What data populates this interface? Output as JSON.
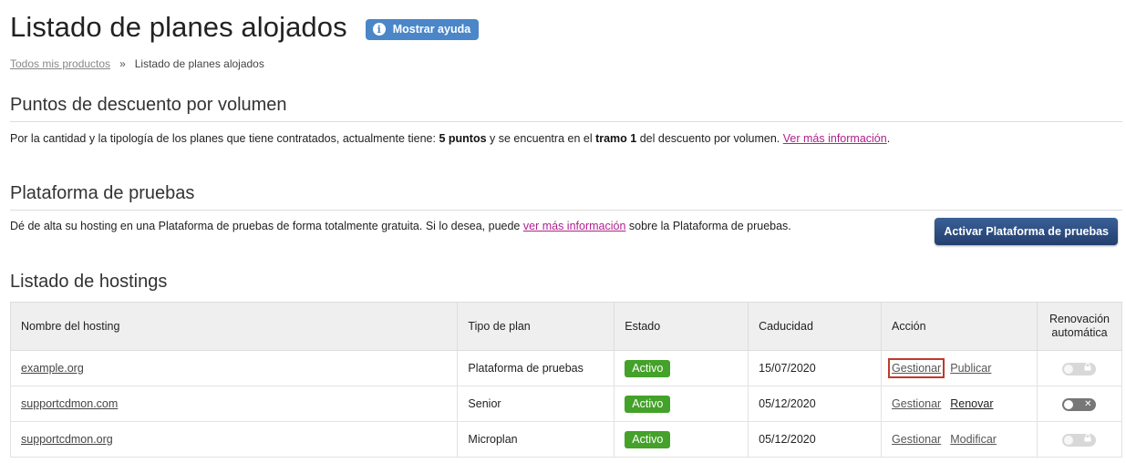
{
  "header": {
    "title": "Listado de planes alojados",
    "help_label": "Mostrar ayuda"
  },
  "breadcrumb": {
    "root": "Todos mis productos",
    "separator": "»",
    "current": "Listado de planes alojados"
  },
  "discount": {
    "heading": "Puntos de descuento por volumen",
    "text_1": "Por la cantidad y la tipología de los planes que tiene contratados, actualmente tiene: ",
    "points": "5 puntos",
    "text_2": " y se encuentra en el ",
    "tier": "tramo 1",
    "text_3": " del descuento por volumen. ",
    "link": "Ver más información",
    "text_4": "."
  },
  "testing": {
    "heading": "Plataforma de pruebas",
    "text_1": "Dé de alta su hosting en una Plataforma de pruebas de forma totalmente gratuita. Si lo desea, puede ",
    "link": "ver más información",
    "text_2": " sobre la Plataforma de pruebas.",
    "button": "Activar Plataforma de pruebas"
  },
  "hostings": {
    "heading": "Listado de hostings",
    "columns": {
      "name": "Nombre del hosting",
      "plan": "Tipo de plan",
      "status": "Estado",
      "expiry": "Caducidad",
      "action": "Acción",
      "renewal": "Renovación automática"
    },
    "rows": [
      {
        "name": "example.org",
        "plan": "Plataforma de pruebas",
        "status": "Activo",
        "expiry": "15/07/2020",
        "action_1": "Gestionar",
        "action_2": "Publicar",
        "renewal_icon": "lock-icon"
      },
      {
        "name": "supportcdmon.com",
        "plan": "Senior",
        "status": "Activo",
        "expiry": "05/12/2020",
        "action_1": "Gestionar",
        "action_2": "Renovar",
        "renewal_icon": "x-icon"
      },
      {
        "name": "supportcdmon.org",
        "plan": "Microplan",
        "status": "Activo",
        "expiry": "05/12/2020",
        "action_1": "Gestionar",
        "action_2": "Modificar",
        "renewal_icon": "lock-icon"
      }
    ]
  },
  "colors": {
    "help_button": "#4a86c8",
    "primary_button": "#2b4a7e",
    "status_active": "#44a12a",
    "link_magenta": "#b0208e",
    "highlight": "#c0392b"
  }
}
